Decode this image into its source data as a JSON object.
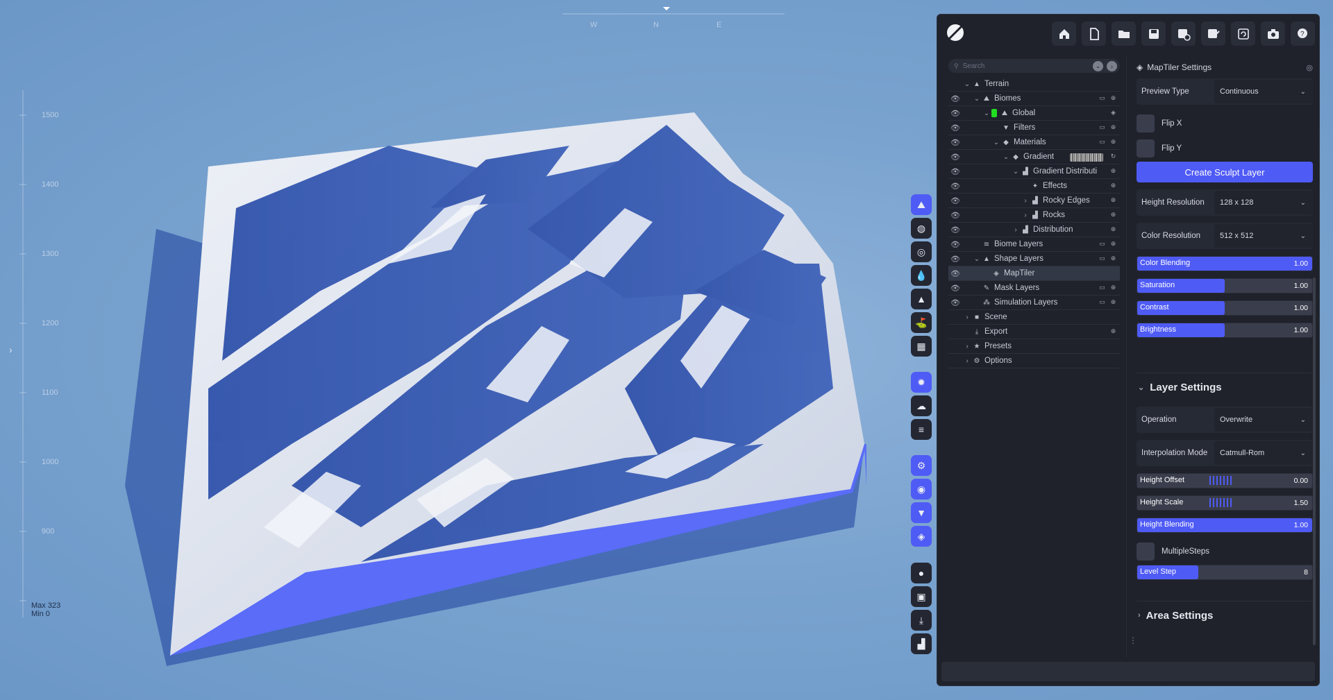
{
  "viewport": {
    "compass": [
      "W",
      "N",
      "E"
    ],
    "ruler_labels": [
      "1500",
      "1400",
      "1300",
      "1200",
      "1100",
      "1000",
      "900"
    ],
    "max_label": "Max 323",
    "min_label": "Min 0",
    "colors": {
      "sky": "#7aa3cf",
      "terrain_side": "#5a6cf8",
      "snow": "#e8ecf4",
      "rock": "#2c4fa3"
    }
  },
  "tool_strip": [
    {
      "icon": "terrain-icon",
      "active": true
    },
    {
      "icon": "globe-icon"
    },
    {
      "icon": "target-icon"
    },
    {
      "icon": "water-drop-icon"
    },
    {
      "icon": "mountain-icon"
    },
    {
      "icon": "landscape-icon"
    },
    {
      "icon": "grid-icon"
    },
    {
      "icon": "sun-icon",
      "active": true
    },
    {
      "icon": "cloud-icon"
    },
    {
      "icon": "layers-lines-icon"
    },
    {
      "icon": "settings-gear-icon",
      "active": true
    },
    {
      "icon": "eye-icon",
      "active": true
    },
    {
      "icon": "filter-icon",
      "active": true
    },
    {
      "icon": "stack-icon",
      "active": true
    },
    {
      "icon": "record-icon"
    },
    {
      "icon": "image-icon"
    },
    {
      "icon": "download-icon"
    },
    {
      "icon": "stats-icon"
    }
  ],
  "toolbar": [
    "home-icon",
    "new-file-icon",
    "open-folder-icon",
    "save-icon",
    "save-as-icon",
    "export-edit-icon",
    "refresh-icon",
    "camera-icon",
    "help-icon"
  ],
  "search": {
    "placeholder": "Search"
  },
  "tree": [
    {
      "label": "Terrain",
      "depth": 0,
      "chev": "v",
      "icon": "▲",
      "eye": false,
      "actions": []
    },
    {
      "label": "Biomes",
      "depth": 1,
      "chev": "v",
      "icon": "⛰",
      "eye": true,
      "actions": [
        "folder",
        "plus"
      ]
    },
    {
      "label": "Global",
      "depth": 2,
      "chev": "v",
      "icon": "⛰",
      "eye": true,
      "swatch": true,
      "actions": [
        "layers"
      ]
    },
    {
      "label": "Filters",
      "depth": 3,
      "chev": "",
      "icon": "▼",
      "eye": true,
      "actions": [
        "folder",
        "plus"
      ]
    },
    {
      "label": "Materials",
      "depth": 3,
      "chev": "v",
      "icon": "◆",
      "eye": true,
      "actions": [
        "folder",
        "plus"
      ]
    },
    {
      "label": "Gradient",
      "depth": 4,
      "chev": "v",
      "icon": "◆",
      "eye": true,
      "gradient": true,
      "actions": [
        "refresh"
      ]
    },
    {
      "label": "Gradient Distributi",
      "depth": 5,
      "chev": "v",
      "icon": "▟",
      "eye": true,
      "actions": [
        "plus"
      ]
    },
    {
      "label": "Effects",
      "depth": 6,
      "chev": "",
      "icon": "✦",
      "eye": true,
      "actions": [
        "plus"
      ]
    },
    {
      "label": "Rocky Edges",
      "depth": 6,
      "chev": ">",
      "icon": "▟",
      "eye": true,
      "actions": [
        "plus"
      ]
    },
    {
      "label": "Rocks",
      "depth": 6,
      "chev": ">",
      "icon": "▟",
      "eye": true,
      "actions": [
        "plus"
      ]
    },
    {
      "label": "Distribution",
      "depth": 5,
      "chev": ">",
      "icon": "▟",
      "eye": true,
      "actions": [
        "plus"
      ]
    },
    {
      "label": "Biome Layers",
      "depth": 1,
      "chev": "",
      "icon": "≋",
      "eye": true,
      "actions": [
        "folder",
        "plus"
      ]
    },
    {
      "label": "Shape Layers",
      "depth": 1,
      "chev": "v",
      "icon": "▲",
      "eye": true,
      "actions": [
        "folder",
        "plus"
      ]
    },
    {
      "label": "MapTiler",
      "depth": 2,
      "chev": "",
      "icon": "◈",
      "eye": true,
      "selected": true,
      "actions": []
    },
    {
      "label": "Mask Layers",
      "depth": 1,
      "chev": "",
      "icon": "✎",
      "eye": true,
      "actions": [
        "folder",
        "plus"
      ]
    },
    {
      "label": "Simulation Layers",
      "depth": 1,
      "chev": "",
      "icon": "⁂",
      "eye": true,
      "actions": [
        "folder",
        "plus"
      ]
    },
    {
      "label": "Scene",
      "depth": 0,
      "chev": ">",
      "icon": "■",
      "eye": false,
      "actions": []
    },
    {
      "label": "Export",
      "depth": 0,
      "chev": "",
      "icon": "⤓",
      "eye": false,
      "actions": [
        "plus"
      ]
    },
    {
      "label": "Presets",
      "depth": 0,
      "chev": ">",
      "icon": "★",
      "eye": false,
      "actions": []
    },
    {
      "label": "Options",
      "depth": 0,
      "chev": ">",
      "icon": "⚙",
      "eye": false,
      "actions": []
    }
  ],
  "settings": {
    "title": "MapTiler Settings",
    "preview_type": {
      "label": "Preview Type",
      "value": "Continuous"
    },
    "flip_x": "Flip X",
    "flip_y": "Flip Y",
    "create_button": "Create Sculpt Layer",
    "height_resolution": {
      "label": "Height Resolution",
      "value": "128 x 128"
    },
    "color_resolution": {
      "label": "Color Resolution",
      "value": "512 x 512"
    },
    "sliders": [
      {
        "label": "Color Blending",
        "value": "1.00",
        "fill": 1.0
      },
      {
        "label": "Saturation",
        "value": "1.00",
        "fill": 0.5
      },
      {
        "label": "Contrast",
        "value": "1.00",
        "fill": 0.5
      },
      {
        "label": "Brightness",
        "value": "1.00",
        "fill": 0.5
      }
    ]
  },
  "layer_settings": {
    "title": "Layer Settings",
    "operation": {
      "label": "Operation",
      "value": "Overwrite"
    },
    "interpolation": {
      "label": "Interpolation Mode",
      "value": "Catmull-Rom"
    },
    "height_offset": {
      "label": "Height Offset",
      "value": "0.00"
    },
    "height_scale": {
      "label": "Height Scale",
      "value": "1.50"
    },
    "height_blending": {
      "label": "Height Blending",
      "value": "1.00",
      "fill": 1.0
    },
    "multiple_steps": "MultipleSteps",
    "level_step": {
      "label": "Level Step",
      "value": "8",
      "fill": 0.35
    }
  },
  "area_settings": {
    "title": "Area Settings"
  }
}
